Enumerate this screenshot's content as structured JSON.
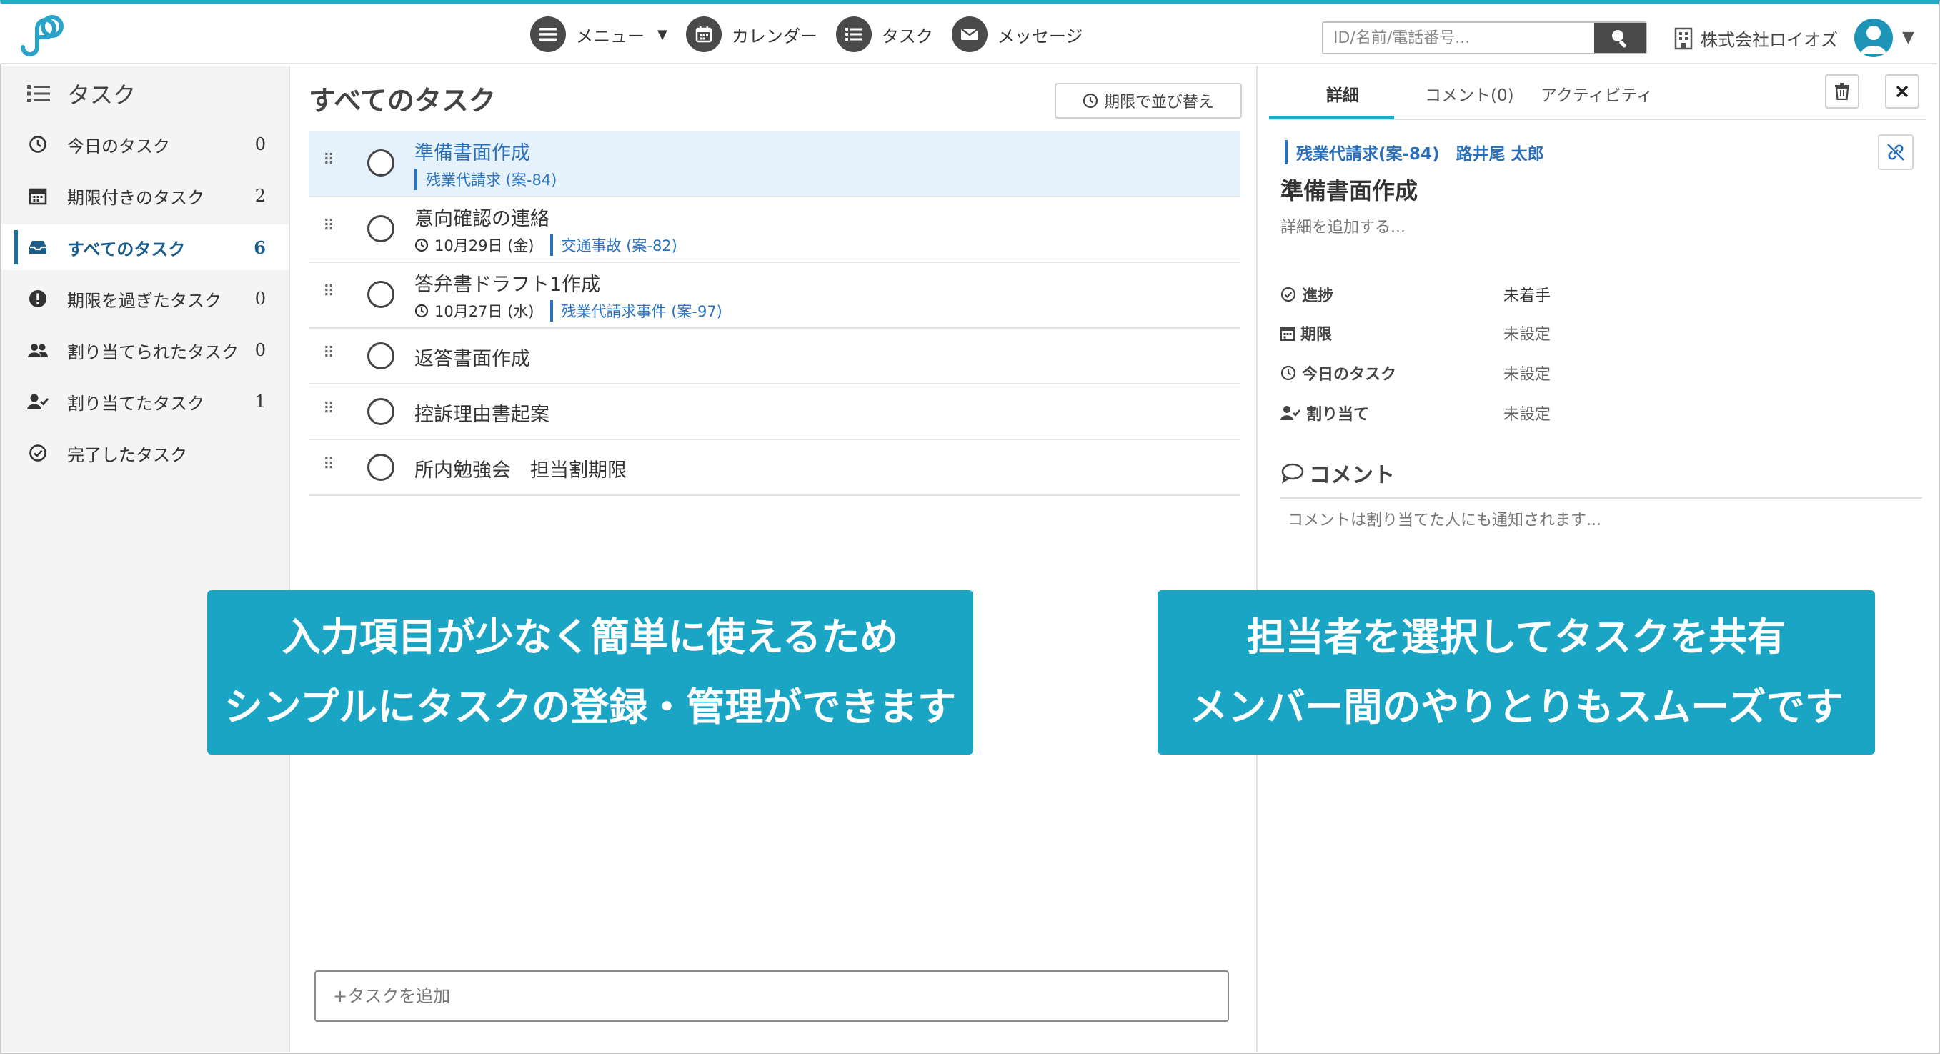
{
  "colors": {
    "accent": "#1ba5c5",
    "link": "#2a73c2",
    "selected_row": "#e6f2fb",
    "icon_dark": "#4a4a4a"
  },
  "header": {
    "logo": "logo-icon",
    "nav": [
      {
        "label": "メニュー",
        "icon": "menu-icon",
        "has_dropdown": true
      },
      {
        "label": "カレンダー",
        "icon": "calendar-icon"
      },
      {
        "label": "タスク",
        "icon": "task-list-icon"
      },
      {
        "label": "メッセージ",
        "icon": "mail-icon"
      }
    ],
    "search": {
      "placeholder": "ID/名前/電話番号...",
      "value": ""
    },
    "company": "株式会社ロイオズ"
  },
  "sidebar": {
    "title": "タスク",
    "items": [
      {
        "label": "今日のタスク",
        "count": "0",
        "icon": "clock-icon"
      },
      {
        "label": "期限付きのタスク",
        "count": "2",
        "icon": "calendar-icon"
      },
      {
        "label": "すべてのタスク",
        "count": "6",
        "icon": "inbox-icon",
        "active": true
      },
      {
        "label": "期限を過ぎたタスク",
        "count": "0",
        "icon": "alert-icon"
      },
      {
        "label": "割り当てられたタスク",
        "count": "0",
        "icon": "users-icon"
      },
      {
        "label": "割り当てたタスク",
        "count": "1",
        "icon": "user-check-icon"
      },
      {
        "label": "完了したタスク",
        "count": "",
        "icon": "check-circle-icon"
      }
    ]
  },
  "main": {
    "title": "すべてのタスク",
    "sort_label": "期限で並び替え",
    "tasks": [
      {
        "name": "準備書面作成",
        "due": "",
        "case": "残業代請求 (案-84)",
        "selected": true
      },
      {
        "name": "意向確認の連絡",
        "due": "10月29日 (金)",
        "case": "交通事故 (案-82)"
      },
      {
        "name": "答弁書ドラフト1作成",
        "due": "10月27日 (水)",
        "case": "残業代請求事件 (案-97)"
      },
      {
        "name": "返答書面作成",
        "due": "",
        "case": ""
      },
      {
        "name": "控訴理由書起案",
        "due": "",
        "case": ""
      },
      {
        "name": "所内勉強会　担当割期限",
        "due": "",
        "case": ""
      }
    ],
    "add_placeholder": "+タスクを追加"
  },
  "detail": {
    "tabs": [
      "詳細",
      "コメント(0)",
      "アクティビティ"
    ],
    "case_link": "残業代請求(案-84)　路井尾 太郎",
    "title": "準備書面作成",
    "desc_placeholder": "詳細を追加する...",
    "props": [
      {
        "label": "進捗",
        "value": "未着手",
        "icon": "progress-icon"
      },
      {
        "label": "期限",
        "value": "未設定",
        "icon": "calendar-icon"
      },
      {
        "label": "今日のタスク",
        "value": "未設定",
        "icon": "clock-icon"
      },
      {
        "label": "割り当て",
        "value": "未設定",
        "icon": "user-check-icon"
      }
    ],
    "comment_heading": "コメント",
    "comment_placeholder": "コメントは割り当てた人にも通知されます..."
  },
  "callouts": {
    "left": [
      "入力項目が少なく簡単に使えるため",
      "シンプルにタスクの登録・管理ができます"
    ],
    "right": [
      "担当者を選択してタスクを共有",
      "メンバー間のやりとりもスムーズです"
    ]
  }
}
